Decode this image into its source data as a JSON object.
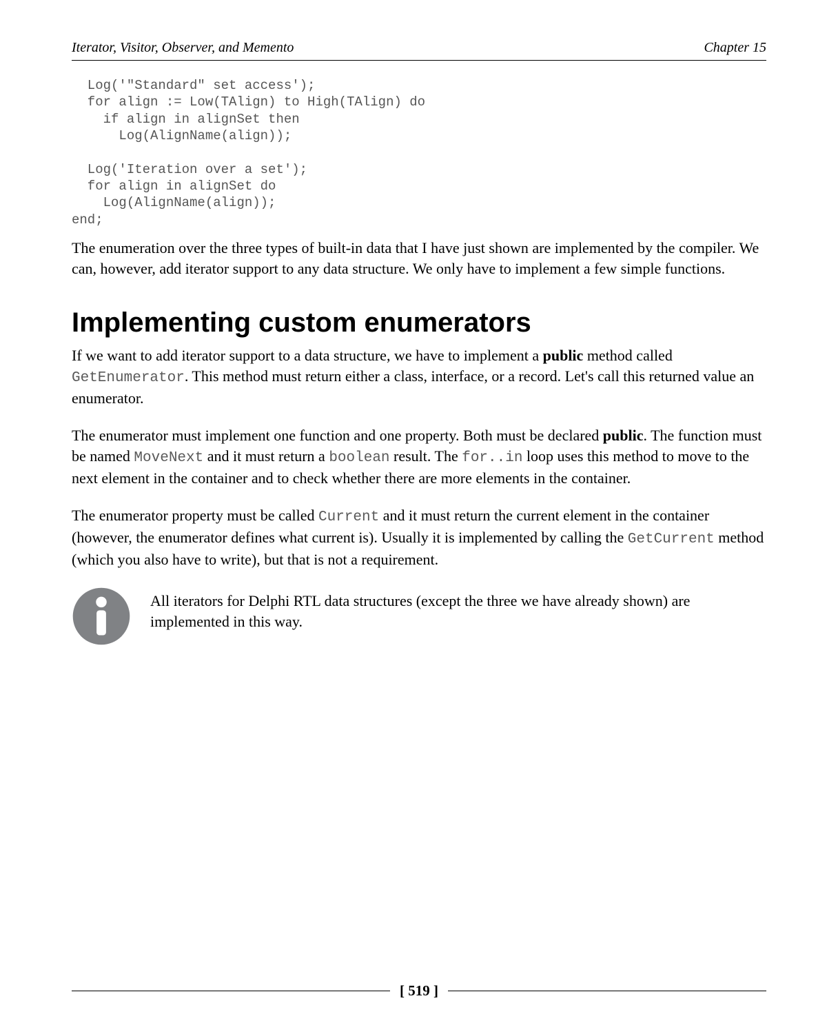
{
  "header": {
    "left": "Iterator, Visitor, Observer, and Memento",
    "right": "Chapter 15"
  },
  "code_block": "  Log('\"Standard\" set access');\n  for align := Low(TAlign) to High(TAlign) do\n    if align in alignSet then\n      Log(AlignName(align));\n\n  Log('Iteration over a set');\n  for align in alignSet do\n    Log(AlignName(align));\nend;",
  "para1": "The enumeration over the three types of built-in data that I have just shown are implemented by the compiler. We can, however, add iterator support to any data structure. We only have to implement a few simple functions.",
  "section_title": "Implementing custom enumerators",
  "para2_a": "If we want to add iterator support to a data structure, we have to implement a ",
  "para2_bold": "public",
  "para2_b": " method called ",
  "para2_code": "GetEnumerator",
  "para2_c": ". This method must return either a class, interface, or a record. Let's call this returned value an enumerator.",
  "para3_a": "The enumerator must implement one function and one property. Both must be declared ",
  "para3_bold": "public",
  "para3_b": ". The function must be named ",
  "para3_code1": "MoveNext",
  "para3_c": " and it must return a ",
  "para3_code2": "boolean",
  "para3_d": " result. The ",
  "para3_code3": "for..in",
  "para3_e": " loop uses this method to move to the next element in the container and to check whether there are more elements in the container.",
  "para4_a": "The enumerator property must be called ",
  "para4_code1": "Current",
  "para4_b": " and it must return the current element in the container (however, the enumerator defines what current is). Usually it is implemented by calling the ",
  "para4_code2": "GetCurrent",
  "para4_c": " method (which you also have to write), but that is not a requirement.",
  "note": "All iterators for Delphi RTL data structures (except the three we have already shown) are implemented in this way.",
  "page_number": "[ 519 ]"
}
